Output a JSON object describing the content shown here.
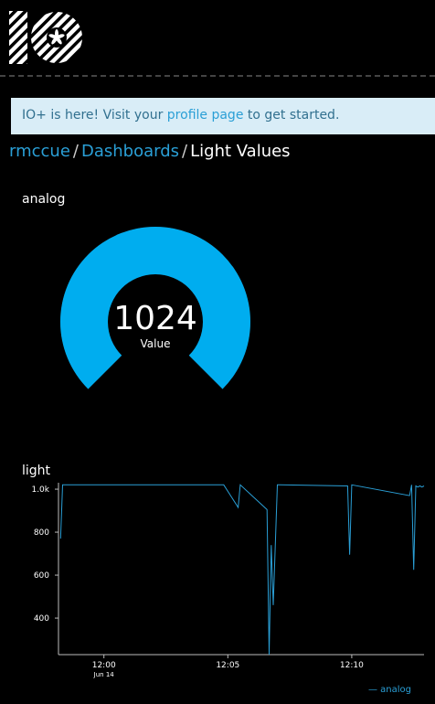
{
  "banner": {
    "prefix": "IO+ is here! Visit your ",
    "link": "profile page",
    "suffix": " to get started."
  },
  "breadcrumb": {
    "user": "rmccue",
    "dashboards": "Dashboards",
    "current": "Light Values",
    "sep": "/"
  },
  "analog_block": {
    "title": "analog"
  },
  "gauge": {
    "value": 1024,
    "value_text": "1024",
    "label": "Value",
    "min": 0,
    "max": 1024,
    "color": "#00adef"
  },
  "light_block": {
    "title": "light"
  },
  "chart_data": {
    "type": "line",
    "title": "light",
    "xlabel": "",
    "ylabel": "",
    "ylim": [
      230,
      1030
    ],
    "xlim": [
      "11:58:10",
      "12:12:55"
    ],
    "y_ticks": [
      {
        "value": 1000,
        "label": "1.0k"
      },
      {
        "value": 800,
        "label": "800"
      },
      {
        "value": 600,
        "label": "600"
      },
      {
        "value": 400,
        "label": "400"
      }
    ],
    "x_ticks": [
      {
        "value": "12:00",
        "label": "12:00",
        "sublabel": "Jun 14"
      },
      {
        "value": "12:05",
        "label": "12:05",
        "sublabel": ""
      },
      {
        "value": "12:10",
        "label": "12:10",
        "sublabel": ""
      }
    ],
    "series": [
      {
        "name": "analog",
        "color": "#2a9fd6",
        "x": [
          "11:58:15",
          "11:58:20",
          "12:04:50",
          "12:05:25",
          "12:05:30",
          "12:06:35",
          "12:06:40",
          "12:06:45",
          "12:06:50",
          "12:07:00",
          "12:07:05",
          "12:09:50",
          "12:09:55",
          "12:10:00",
          "12:12:20",
          "12:12:25",
          "12:12:30",
          "12:12:35",
          "12:12:40",
          "12:12:45",
          "12:12:50",
          "12:12:55"
        ],
        "y": [
          770,
          1020,
          1020,
          915,
          1020,
          905,
          230,
          740,
          460,
          1020,
          1020,
          1015,
          695,
          1020,
          970,
          1020,
          625,
          1015,
          1010,
          1015,
          1010,
          1015
        ]
      }
    ]
  },
  "legend": {
    "label": "— analog"
  }
}
